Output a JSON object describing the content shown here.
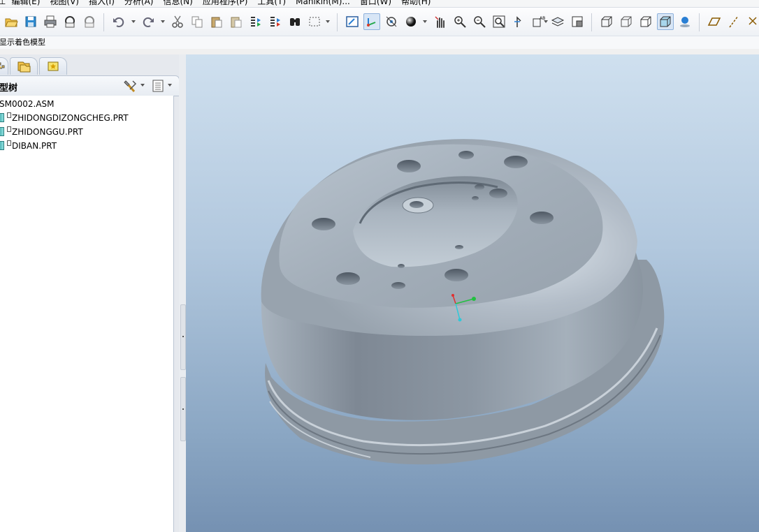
{
  "menu": {
    "items": [
      "⊥",
      "编辑(E)",
      "视图(V)",
      "插入(I)",
      "分析(A)",
      "信息(N)",
      "应用程序(P)",
      "工具(T)",
      "Manikin(M)...",
      "窗口(W)",
      "帮助(H)"
    ]
  },
  "status": {
    "message": "显示着色模型"
  },
  "panel": {
    "title": "型树"
  },
  "tree": {
    "root": "SM0002.ASM",
    "items": [
      {
        "label": "ZHIDONGDIZONGCHEG.PRT"
      },
      {
        "label": "ZHIDONGGU.PRT"
      },
      {
        "label": "DIBAN.PRT"
      }
    ]
  },
  "toolbar": {
    "icons": [
      "open-folder-icon",
      "save-icon",
      "print-icon",
      "email-icon",
      "email-attach-icon",
      "undo-icon",
      "redo-icon",
      "cut-icon",
      "copy-icon",
      "paste-icon",
      "paste-special-icon",
      "regenerate-icon",
      "regenerate-manager-icon",
      "find-icon",
      "select-box-icon",
      "repaint-icon",
      "spin-center-icon",
      "orient-mode-icon",
      "appearance-sphere-icon",
      "pan-hand-icon",
      "zoom-in-icon",
      "zoom-out-icon",
      "refit-icon",
      "reorient-icon",
      "saved-views-icon",
      "layers-icon",
      "view-manager-icon",
      "wireframe-icon",
      "hidden-line-icon",
      "no-hidden-icon",
      "shading-icon",
      "enhanced-realism-icon",
      "datum-planes-icon",
      "datum-axes-icon",
      "datum-points-icon"
    ]
  },
  "colors": {
    "accent": "#4a8ad4",
    "viewport_top": "#cfe0ef",
    "viewport_bottom": "#7591b2",
    "model_gray": "#9aa5b1"
  }
}
